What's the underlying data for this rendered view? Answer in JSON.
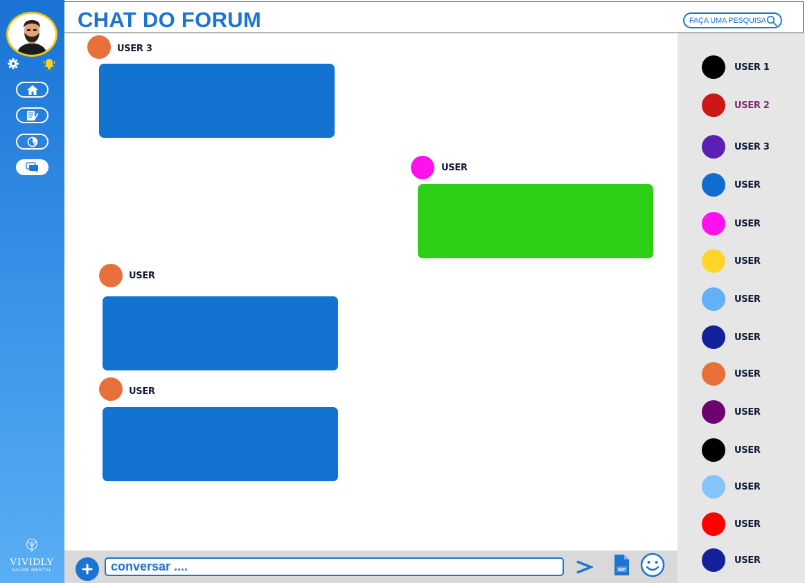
{
  "header": {
    "title": "CHAT DO FORUM",
    "search_placeholder": "FAÇA UMA PESQUISA"
  },
  "sidebar": {
    "logo_name": "VIVIDLY",
    "logo_subtitle": "SAÚDE MENTAL",
    "nav": [
      {
        "icon": "home-icon"
      },
      {
        "icon": "notes-icon"
      },
      {
        "icon": "chart-icon"
      },
      {
        "icon": "chat-icon",
        "active": true
      }
    ]
  },
  "messages": [
    {
      "user": "USER 3",
      "avatar_color": "#e8703a",
      "bubble_color": "#1373d0",
      "side": "left"
    },
    {
      "user": "USER",
      "avatar_color": "#ff10ef",
      "bubble_color": "#2ccf16",
      "side": "right"
    },
    {
      "user": "USER",
      "avatar_color": "#e8703a",
      "bubble_color": "#1373d0",
      "side": "left"
    },
    {
      "user": "USER",
      "avatar_color": "#e8703a",
      "bubble_color": "#1373d0",
      "side": "left"
    }
  ],
  "users": [
    {
      "name": "USER 1",
      "color": "#000000"
    },
    {
      "name": "USER 2",
      "color": "#cc1717",
      "highlight": true
    },
    {
      "name": "USER 3",
      "color": "#5b1fb5"
    },
    {
      "name": "USER",
      "color": "#106dd0"
    },
    {
      "name": "USER",
      "color": "#ff10ef"
    },
    {
      "name": "USER",
      "color": "#fed62b"
    },
    {
      "name": "USER",
      "color": "#62b0f7"
    },
    {
      "name": "USER",
      "color": "#14219a"
    },
    {
      "name": "USER",
      "color": "#e8703a"
    },
    {
      "name": "USER",
      "color": "#6e0170"
    },
    {
      "name": "USER",
      "color": "#000000"
    },
    {
      "name": "USER",
      "color": "#86c3fb"
    },
    {
      "name": "USER",
      "color": "#ff0000"
    },
    {
      "name": "USER",
      "color": "#14219a"
    }
  ],
  "composer": {
    "placeholder": "conversar ...."
  },
  "colors": {
    "accent": "#1b74d3",
    "avatar_ring": "#f2c811"
  }
}
